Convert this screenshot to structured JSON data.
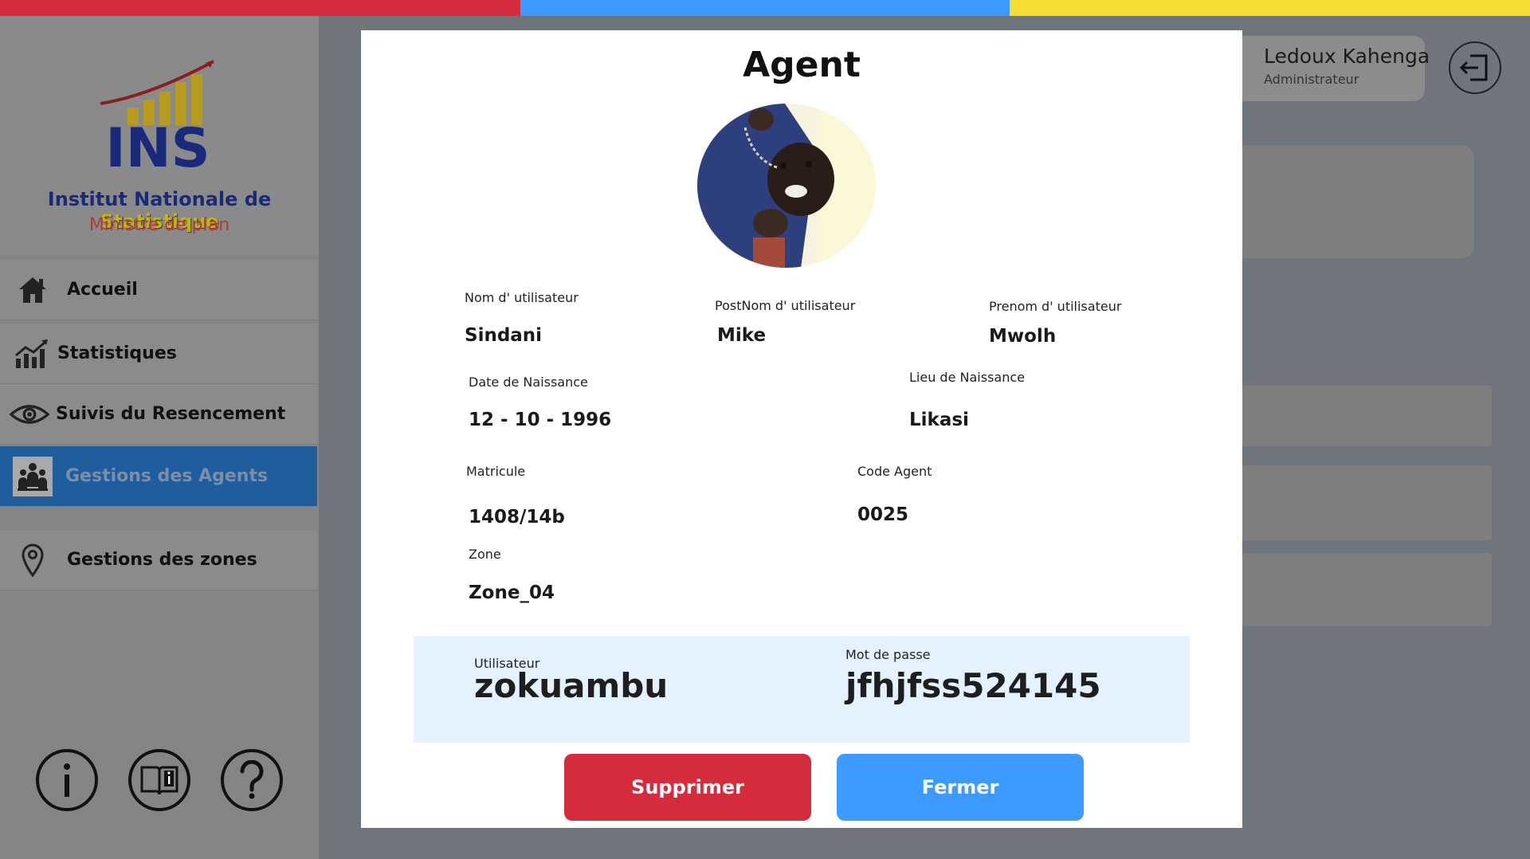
{
  "colors": {
    "stripe_red": "#d42b3d",
    "stripe_blue": "#3d9bff",
    "stripe_yellow": "#f6dd33",
    "active_nav": "#1f5d9c",
    "danger": "#d42b3d",
    "primary": "#3d9bff",
    "credential_bg": "#e4f1ff"
  },
  "sidebar": {
    "logo_text": "INS",
    "org_name_part1": "Institut Nationale de",
    "org_name_part2": "Statistique",
    "ministry": "Ministre de plan",
    "items": [
      {
        "label": "Accueil",
        "icon": "home-icon"
      },
      {
        "label": "Statistiques",
        "icon": "chart-icon"
      },
      {
        "label": "Suivis du Resencement",
        "icon": "eye-icon"
      },
      {
        "label": "Gestions des Agents",
        "icon": "agents-icon",
        "active": true
      },
      {
        "label": "Gestions des zones",
        "icon": "location-pin-icon"
      }
    ],
    "bottom_icons": [
      "info-icon",
      "book-info-icon",
      "help-icon"
    ]
  },
  "header": {
    "user_name": "Ledoux Kahenga",
    "user_role": "Administrateur",
    "logout_icon": "logout-icon"
  },
  "modal": {
    "title": "Agent",
    "fields": {
      "nom_label": "Nom d' utilisateur",
      "nom_value": "Sindani",
      "postnom_label": "PostNom d' utilisateur",
      "postnom_value": "Mike",
      "prenom_label": "Prenom d' utilisateur",
      "prenom_value": "Mwolh",
      "naissance_label": "Date de Naissance",
      "naissance_value": "12 - 10 - 1996",
      "lieu_label": "Lieu de Naissance",
      "lieu_value": "Likasi",
      "matricule_label": "Matricule",
      "matricule_value": "1408/14b",
      "code_label": "Code Agent",
      "code_value": "0025",
      "zone_label": "Zone",
      "zone_value": "Zone_04"
    },
    "credentials": {
      "user_label": "Utilisateur",
      "user_value": "zokuambu",
      "password_label": "Mot de passe",
      "password_value": "jfhjfss524145"
    },
    "buttons": {
      "delete": "Supprimer",
      "close": "Fermer"
    }
  }
}
